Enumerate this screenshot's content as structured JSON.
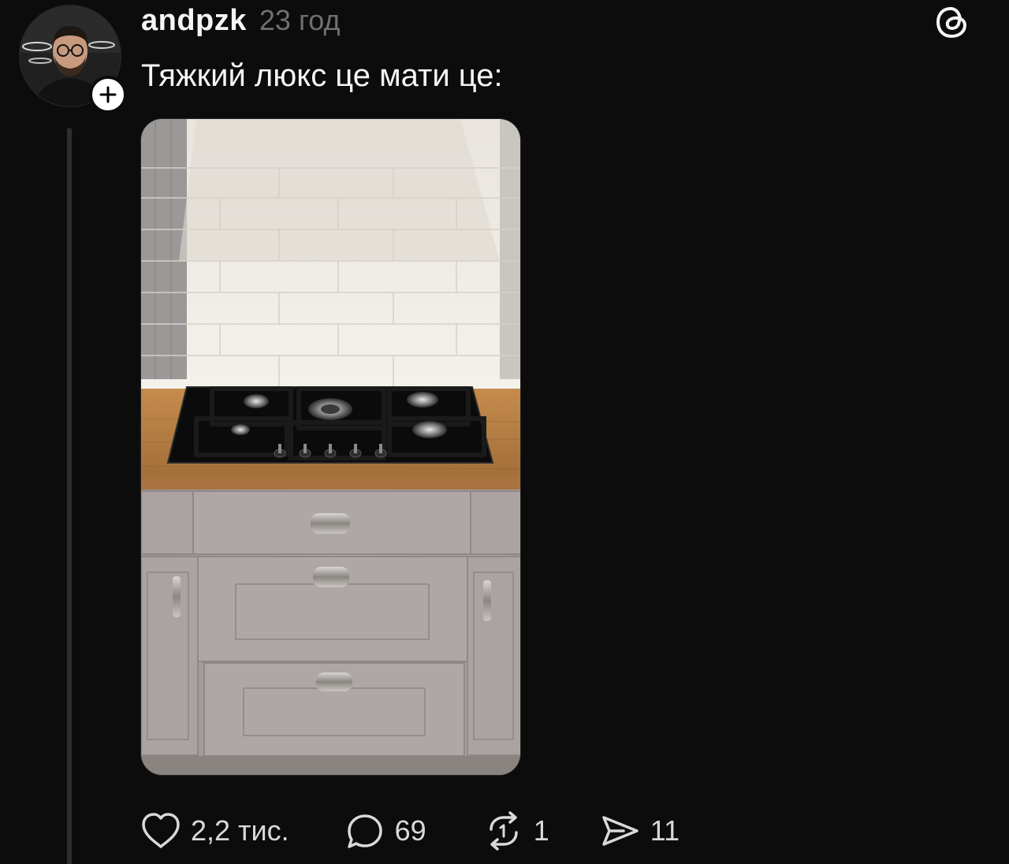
{
  "post": {
    "username": "andpzk",
    "timestamp": "23 год",
    "text": "Тяжкий люкс це мати це:"
  },
  "actions": {
    "like_count": "2,2 тис.",
    "reply_count": "69",
    "repost_count": "1",
    "share_count": "11"
  },
  "icons": {
    "like": "heart-icon",
    "reply": "speech-bubble-icon",
    "repost": "repost-arrows-icon",
    "share": "paper-plane-icon",
    "brand": "threads-logo-icon",
    "follow": "plus-icon"
  },
  "colors": {
    "background": "#0c0c0c",
    "text": "#f5f5f5",
    "muted": "#6f6f6f",
    "thread_line": "#2e2e2e"
  }
}
